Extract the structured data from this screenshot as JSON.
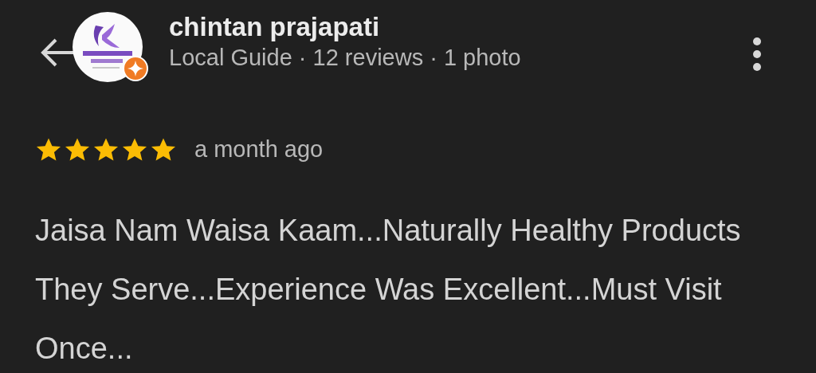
{
  "reviewer": {
    "name": "chintan prajapati",
    "local_guide": true,
    "subtitle": "Local Guide · 12 reviews · 1 photo"
  },
  "review": {
    "stars": 5,
    "time": "a month ago",
    "text": "Jaisa Nam Waisa Kaam...Naturally Healthy Products They Serve...Experience Was Excellent...Must Visit Once..."
  }
}
